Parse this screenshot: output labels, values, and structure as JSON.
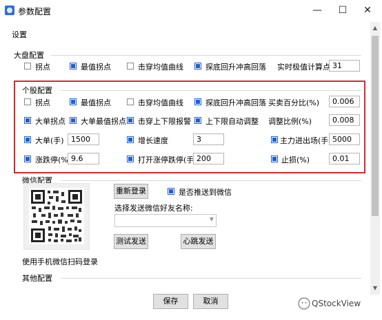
{
  "window": {
    "title": "参数配置",
    "minimize": "—",
    "maximize": "☐",
    "close": "✕"
  },
  "settings_label": "设置",
  "market": {
    "title": "大盘配置",
    "items": [
      {
        "label": "拐点",
        "checked": false
      },
      {
        "label": "最值拐点",
        "checked": true
      },
      {
        "label": "击穿均值曲线",
        "checked": false
      },
      {
        "label": "探底回升冲高回落",
        "checked": true
      }
    ],
    "points_label": "实时极值计算点数",
    "points_value": "31"
  },
  "stock": {
    "title": "个股配置",
    "row1": [
      {
        "label": "拐点",
        "checked": false
      },
      {
        "label": "最值拐点",
        "checked": true
      },
      {
        "label": "击穿均值曲线",
        "checked": false
      },
      {
        "label": "探底回升冲高回落",
        "checked": true
      }
    ],
    "buysell_label": "买卖百分比(%)",
    "buysell_value": "0.006",
    "row2": [
      {
        "label": "大单拐点",
        "checked": true
      },
      {
        "label": "大单最值拐点",
        "checked": true
      },
      {
        "label": "击穿上下限报警",
        "checked": true
      },
      {
        "label": "上下限自动调整",
        "checked": true
      }
    ],
    "adjust_label": "调整比例(%)",
    "adjust_value": "0.008",
    "bigorder": {
      "label": "大单(手)",
      "checked": true,
      "value": "1500"
    },
    "growth": {
      "label": "增长速度",
      "checked": true,
      "value": "3"
    },
    "mainflow": {
      "label": "主力进出场(手)",
      "checked": true,
      "value": "5000"
    },
    "limit": {
      "label": "涨跌停(%)",
      "checked": true,
      "value": "9.6"
    },
    "openlimit": {
      "label": "打开涨停跌停(手)",
      "checked": true,
      "value": "200"
    },
    "stoploss": {
      "label": "止损(%)",
      "checked": true,
      "value": "0.01"
    }
  },
  "wechat": {
    "title": "微信配置",
    "relogin": "重新登录",
    "push": {
      "label": "是否推送到微信",
      "checked": true
    },
    "friend_label": "选择发送微信好友名称:",
    "friend_value": "",
    "test_send": "测试发送",
    "heartbeat": "心跳发送",
    "qr_caption": "使用手机微信扫码登录"
  },
  "other_title": "其他配置",
  "footer": {
    "save": "保存",
    "cancel": "取消"
  },
  "watermark": "QStockView",
  "colors": {
    "accent": "#1c5fd1",
    "highlight_box": "#d7262d"
  }
}
